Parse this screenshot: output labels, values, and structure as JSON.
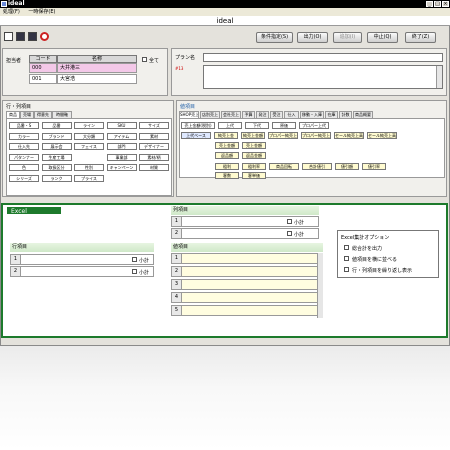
{
  "window": {
    "title": "ideal",
    "app_title": "ideal"
  },
  "menu": [
    "処理(F)",
    "一時保存(E)"
  ],
  "toolbar": {
    "buttons": [
      "条件指定(S)",
      "出力(O)",
      "追加(I)",
      "中止(Q)",
      "終了(Z)"
    ]
  },
  "staff": {
    "label": "担当者",
    "col_code": "コード",
    "col_name": "名称",
    "all_label": "全て",
    "rows": [
      {
        "code": "000",
        "name": "大井港三"
      },
      {
        "code": "001",
        "name": "大宮浩"
      }
    ]
  },
  "plan": {
    "label": "プラン名",
    "sub": "#13"
  },
  "rowcol": {
    "title": "行・列項目",
    "tabs": [
      "商品",
      "売場",
      "得意先",
      "時間軸"
    ],
    "items": [
      "品番・S",
      "品番",
      "ライン",
      "SKU",
      "サイズ",
      "カラー",
      "ブランド",
      "大分類",
      "アイテム",
      "素材",
      "仕入先",
      "展示会",
      "フェイス",
      "部門",
      "デザイナー",
      "パタンナー",
      "生産工場",
      "",
      "事業部",
      "素材/柄",
      "色",
      "取扱区分",
      "性別",
      "キャンペーン",
      "材質",
      "シリーズ",
      "ランク",
      "プライス"
    ]
  },
  "value": {
    "title": "値項目",
    "tabs": [
      "SHOP売上",
      "店別売上",
      "会社売上",
      "予算",
      "発注",
      "受注",
      "仕入",
      "移動・入庫",
      "在庫",
      "計数",
      "商品概要"
    ],
    "row1": [
      "売上金額(税別)",
      "上代",
      "下代",
      "原価",
      "プロパー上代"
    ],
    "row2": [
      "上代ベース",
      "純売上金",
      "純売上金額",
      "プロパー純売上高",
      "プロパー純売上高",
      "セール純売上高",
      "セール純売上高"
    ],
    "row3": [
      "売上金額",
      "売上金額"
    ],
    "row4": [
      "返品額",
      "返品金額"
    ],
    "row5": [
      "粗利",
      "粗利率",
      "商品回転",
      "合計値引",
      "値引額",
      "値引率"
    ],
    "row6": [
      "客数",
      "客単価"
    ]
  },
  "excel": {
    "badge": "Excel",
    "col_items": "列項目",
    "row_items": "行項目",
    "value_items": "値項目",
    "subtotal": "小計",
    "row_numbers_2": [
      "1",
      "2"
    ],
    "row_numbers_5": [
      "1",
      "2",
      "3",
      "4",
      "5"
    ],
    "options_title": "Excel集計オプション",
    "options": [
      "総合計を出力",
      "値項目を横に並べる",
      "行・列項目を繰り返し表示"
    ]
  }
}
